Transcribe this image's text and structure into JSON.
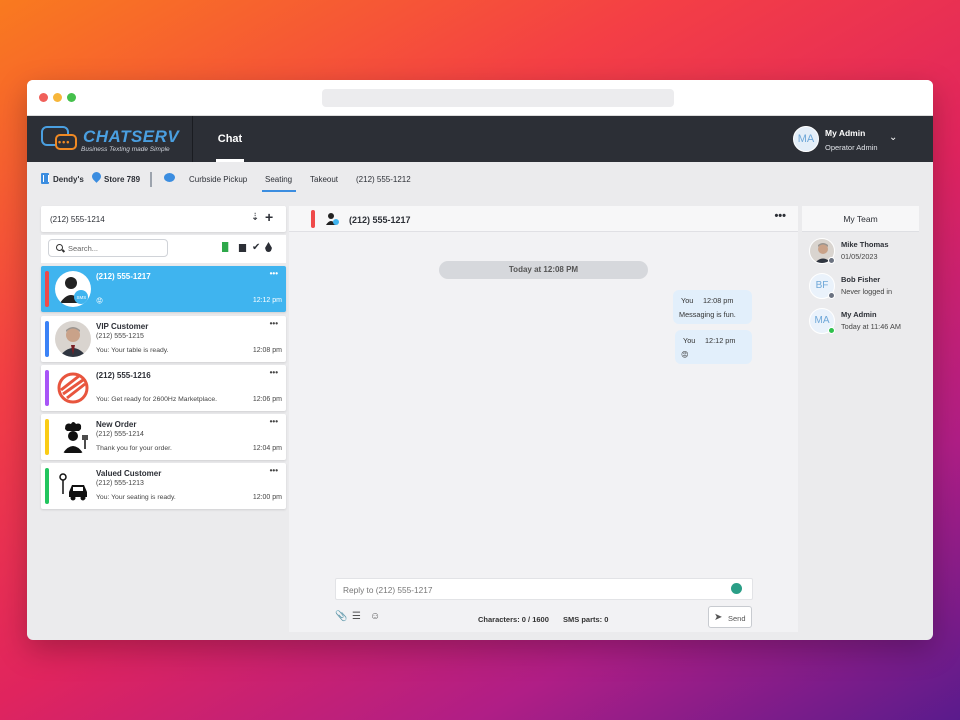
{
  "app": {
    "logo_text": "CHATSERV",
    "tagline": "Business Texting made Simple",
    "nav_active": "Chat",
    "user": {
      "initials": "MA",
      "name": "My Admin",
      "role": "Operator Admin"
    }
  },
  "subbar": {
    "business": "Dendy's",
    "store": "Store 789",
    "tabs": [
      "Curbside Pickup",
      "Seating",
      "Takeout",
      "(212) 555-1212"
    ],
    "active_tab": "Seating"
  },
  "left": {
    "header": "(212) 555-1214",
    "search_placeholder": "Search...",
    "conversations": [
      {
        "title": "(212) 555-1217",
        "number": "",
        "message": "😡",
        "time": "12:12 pm",
        "color": "#ef4a4a",
        "avatar": "sms-user-icon"
      },
      {
        "title": "VIP Customer",
        "number": "(212) 555-1215",
        "message": "You: Your table is ready.",
        "time": "12:08 pm",
        "color": "#3b82f6",
        "avatar": "photo"
      },
      {
        "title": "(212) 555-1216",
        "number": "",
        "message": "You: Get ready for 2600Hz Marketplace.",
        "time": "12:06 pm",
        "color": "#a855f7",
        "avatar": "2600hz-logo"
      },
      {
        "title": "New Order",
        "number": "(212) 555-1214",
        "message": "Thank you for your order.",
        "time": "12:04 pm",
        "color": "#facc15",
        "avatar": "chef-icon"
      },
      {
        "title": "Valued Customer",
        "number": "(212) 555-1213",
        "message": "You: Your seating is ready.",
        "time": "12:00 pm",
        "color": "#22c55e",
        "avatar": "curbside-car-icon"
      }
    ]
  },
  "center": {
    "title": "(212) 555-1217",
    "date_label": "Today at 12:08 PM",
    "messages": [
      {
        "who": "You",
        "time": "12:08 pm",
        "text": "Messaging is fun."
      },
      {
        "who": "You",
        "time": "12:12 pm",
        "text": "😡"
      }
    ],
    "reply_placeholder": "Reply to (212) 555-1217",
    "characters": "Characters: 0 / 1600",
    "sms_parts": "SMS parts: 0",
    "send_label": "Send"
  },
  "team": {
    "title": "My Team",
    "members": [
      {
        "initials": "",
        "name": "Mike Thomas",
        "sub": "01/05/2023",
        "online": false
      },
      {
        "initials": "BF",
        "name": "Bob Fisher",
        "sub": "Never logged in",
        "online": false
      },
      {
        "initials": "MA",
        "name": "My Admin",
        "sub": "Today at 11:46 AM",
        "online": true
      }
    ]
  },
  "colors": {
    "accent": "#3fb4ef",
    "appbar": "#2c2f36",
    "link": "#3b8de0"
  }
}
